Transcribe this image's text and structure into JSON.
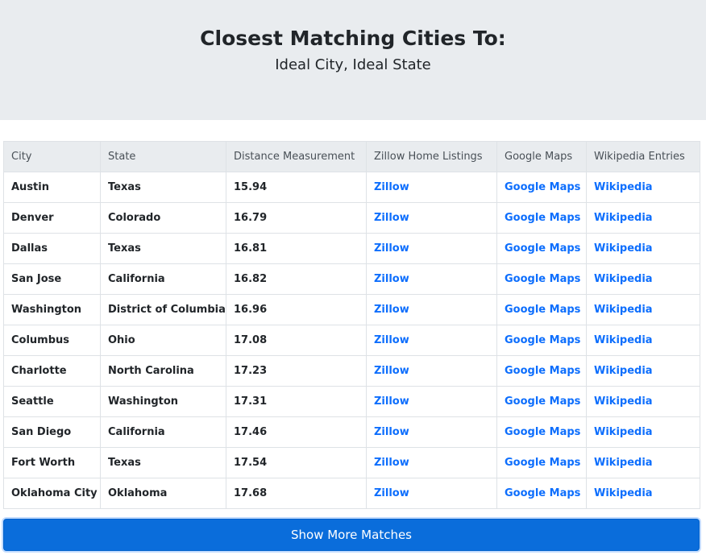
{
  "header": {
    "title": "Closest Matching Cities To:",
    "subtitle": "Ideal City, Ideal State"
  },
  "table": {
    "columns": [
      "City",
      "State",
      "Distance Measurement",
      "Zillow Home Listings",
      "Google Maps",
      "Wikipedia Entries"
    ],
    "rows": [
      {
        "city": "Austin",
        "state": "Texas",
        "distance": "15.94",
        "zillow": "Zillow",
        "maps": "Google Maps",
        "wiki": "Wikipedia"
      },
      {
        "city": "Denver",
        "state": "Colorado",
        "distance": "16.79",
        "zillow": "Zillow",
        "maps": "Google Maps",
        "wiki": "Wikipedia"
      },
      {
        "city": "Dallas",
        "state": "Texas",
        "distance": "16.81",
        "zillow": "Zillow",
        "maps": "Google Maps",
        "wiki": "Wikipedia"
      },
      {
        "city": "San Jose",
        "state": "California",
        "distance": "16.82",
        "zillow": "Zillow",
        "maps": "Google Maps",
        "wiki": "Wikipedia"
      },
      {
        "city": "Washington",
        "state": "District of Columbia",
        "distance": "16.96",
        "zillow": "Zillow",
        "maps": "Google Maps",
        "wiki": "Wikipedia"
      },
      {
        "city": "Columbus",
        "state": "Ohio",
        "distance": "17.08",
        "zillow": "Zillow",
        "maps": "Google Maps",
        "wiki": "Wikipedia"
      },
      {
        "city": "Charlotte",
        "state": "North Carolina",
        "distance": "17.23",
        "zillow": "Zillow",
        "maps": "Google Maps",
        "wiki": "Wikipedia"
      },
      {
        "city": "Seattle",
        "state": "Washington",
        "distance": "17.31",
        "zillow": "Zillow",
        "maps": "Google Maps",
        "wiki": "Wikipedia"
      },
      {
        "city": "San Diego",
        "state": "California",
        "distance": "17.46",
        "zillow": "Zillow",
        "maps": "Google Maps",
        "wiki": "Wikipedia"
      },
      {
        "city": "Fort Worth",
        "state": "Texas",
        "distance": "17.54",
        "zillow": "Zillow",
        "maps": "Google Maps",
        "wiki": "Wikipedia"
      },
      {
        "city": "Oklahoma City",
        "state": "Oklahoma",
        "distance": "17.68",
        "zillow": "Zillow",
        "maps": "Google Maps",
        "wiki": "Wikipedia"
      }
    ]
  },
  "actions": {
    "show_more_label": "Show More Matches"
  },
  "colors": {
    "link": "#0d6efd",
    "button": "#0a6ddb",
    "header_bg": "#e9ecef"
  }
}
